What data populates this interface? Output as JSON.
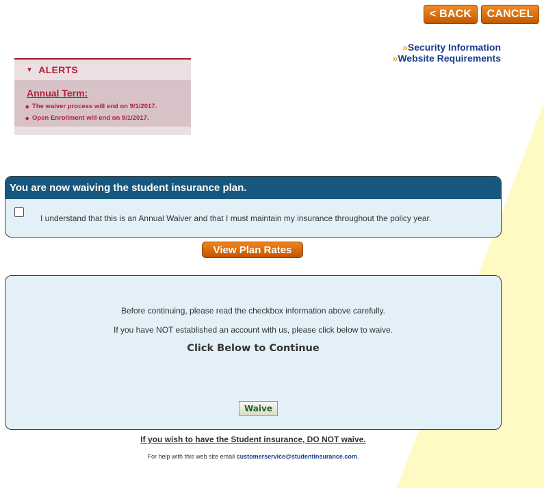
{
  "header": {
    "back_label": "< BACK",
    "cancel_label": "CANCEL",
    "links": [
      {
        "prefix": "»",
        "label": "Security Information"
      },
      {
        "prefix": "»",
        "label": "Website Requirements"
      }
    ]
  },
  "alerts": {
    "title": "ALERTS",
    "term_heading": "Annual Term:",
    "items": [
      "The waiver process will end on 9/1/2017.",
      "Open Enrollment will end on 9/1/2017."
    ]
  },
  "waiver": {
    "heading": "You are now waiving the student insurance plan.",
    "checkbox_text": "I understand that this is an Annual Waiver and that I must maintain my insurance throughout the policy year.",
    "checked": false
  },
  "rates_button": "View Plan Rates",
  "continue_panel": {
    "line1": "Before continuing, please read the checkbox information above carefully.",
    "line2": "If you have NOT established an account with us, please click below to waive.",
    "heading": "Click Below to Continue",
    "waive_button": "Waive"
  },
  "footer": {
    "notice": "If you wish to have the Student insurance, DO NOT waive.",
    "help_prefix": "For help with this web site email ",
    "help_email": "customerservice@studentinsurance.com",
    "help_suffix": "."
  },
  "colors": {
    "accent_orange": "#d96a0c",
    "header_blue": "#17577d",
    "alert_red": "#b3203a",
    "panel_bg": "#e3f0f7",
    "wedge_yellow": "#fff9c4"
  }
}
